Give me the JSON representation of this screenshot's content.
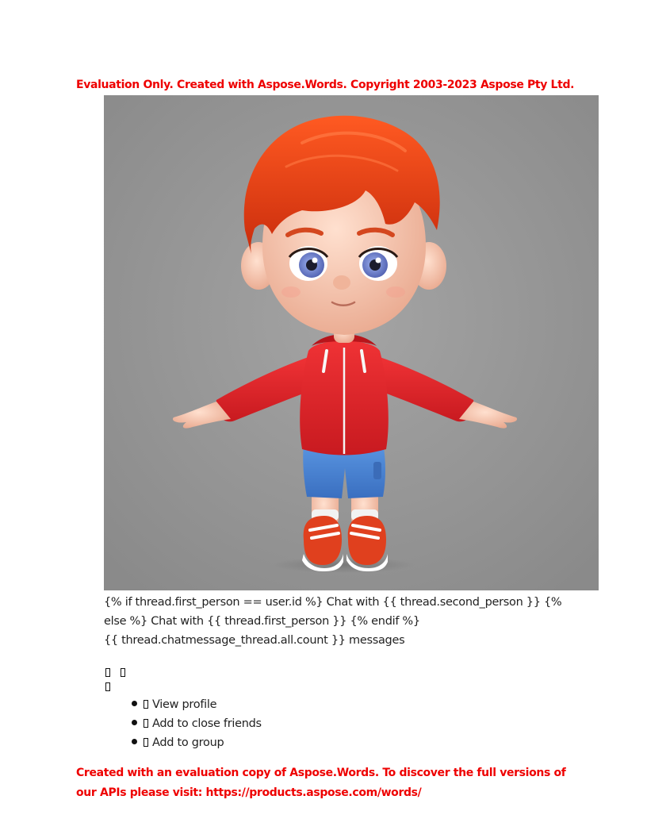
{
  "header_notice": "Evaluation Only. Created with Aspose.Words. Copyright 2003-2023 Aspose Pty Ltd.",
  "template_lines": [
    "{% if thread.first_person == user.id %} Chat with {{ thread.second_person  }} {%",
    "else %} Chat with {{ thread.first_person  }} {% endif %}",
    "{{ thread.chatmessage_thread.all.count  }} messages"
  ],
  "menu": {
    "items": [
      {
        "label": "View profile",
        "icon": "missing-glyph-icon"
      },
      {
        "label": "Add to close friends",
        "icon": "missing-glyph-icon"
      },
      {
        "label": "Add to group",
        "icon": "missing-glyph-icon"
      }
    ]
  },
  "footer_notice": [
    "Created with an evaluation copy of Aspose.Words. To discover the full versions of",
    "our APIs please visit: https://products.aspose.com/words/"
  ],
  "colors": {
    "notice": "#ee0000",
    "hair": "#e8401a",
    "hoodie": "#e8252a",
    "shorts": "#4a86d6",
    "backdrop": "#939393"
  }
}
